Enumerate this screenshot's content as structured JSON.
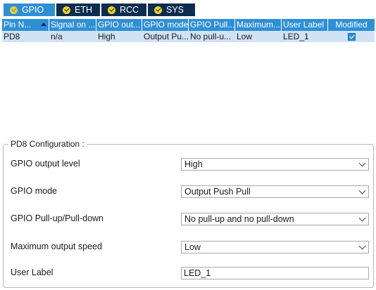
{
  "tabs": [
    {
      "label": "GPIO",
      "active": true
    },
    {
      "label": "ETH",
      "active": false
    },
    {
      "label": "RCC",
      "active": false
    },
    {
      "label": "SYS",
      "active": false
    }
  ],
  "table": {
    "headers": [
      "Pin N...",
      "Signal on ...",
      "GPIO out...",
      "GPIO mode",
      "GPIO Pull...",
      "Maximum...",
      "User Label",
      "Modified"
    ],
    "rows": [
      {
        "pin": "PD8",
        "signal": "n/a",
        "output_level": "High",
        "mode": "Output Pu...",
        "pull": "No pull-u...",
        "max_speed": "Low",
        "user_label": "LED_1",
        "modified": true
      }
    ]
  },
  "config": {
    "title": "PD8 Configuration :",
    "fields": [
      {
        "label": "GPIO output level",
        "value": "High"
      },
      {
        "label": "GPIO mode",
        "value": "Output Push Pull"
      },
      {
        "label": "GPIO Pull-up/Pull-down",
        "value": "No pull-up and no pull-down"
      },
      {
        "label": "Maximum output speed",
        "value": "Low"
      },
      {
        "label": "User Label",
        "value": "LED_1"
      }
    ]
  },
  "colors": {
    "tab_bg": "#0c2d4f",
    "tab_active_bg": "#2f8fd5",
    "header_bg": "#2f8fd5",
    "row_selected_bg": "#cfe3f5",
    "ok_icon": "#f3d027"
  }
}
